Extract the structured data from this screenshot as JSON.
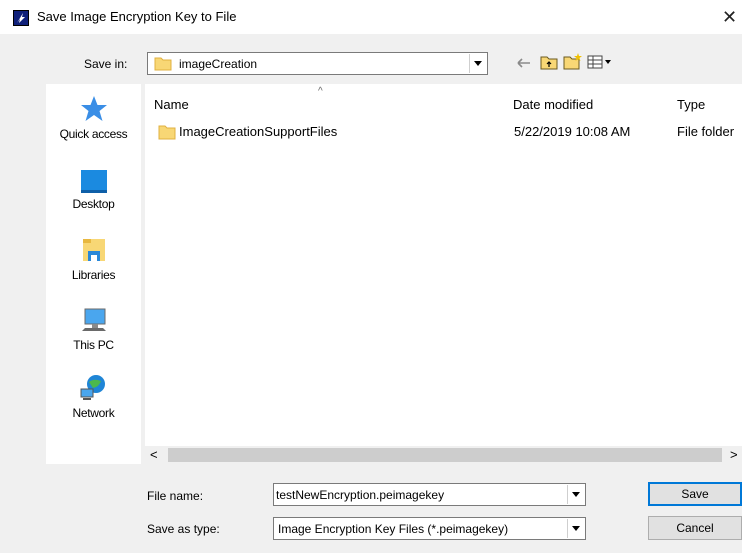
{
  "window": {
    "title": "Save Image Encryption Key to File",
    "close_glyph": "✕"
  },
  "save_in": {
    "label": "Save in:",
    "folder": "imageCreation"
  },
  "places": [
    {
      "label": "Quick access",
      "icon": "star-icon"
    },
    {
      "label": "Desktop",
      "icon": "desktop-icon"
    },
    {
      "label": "Libraries",
      "icon": "libraries-icon"
    },
    {
      "label": "This PC",
      "icon": "computer-icon"
    },
    {
      "label": "Network",
      "icon": "network-icon"
    }
  ],
  "columns": {
    "name": "Name",
    "date": "Date modified",
    "type": "Type"
  },
  "files": [
    {
      "name": "ImageCreationSupportFiles",
      "date": "5/22/2019 10:08 AM",
      "type": "File folder"
    }
  ],
  "file_name": {
    "label": "File name:",
    "value": "testNewEncryption.peimagekey"
  },
  "save_type": {
    "label": "Save as type:",
    "value": "Image Encryption Key Files (*.peimagekey)"
  },
  "buttons": {
    "save": "Save",
    "cancel": "Cancel"
  },
  "colors": {
    "accent": "#0078d7",
    "folder": "#f8d775"
  }
}
